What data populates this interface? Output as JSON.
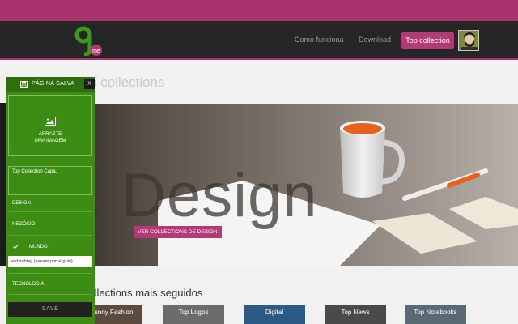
{
  "nav": {
    "logo_text": "me",
    "links": [
      "Como funciona",
      "Download"
    ],
    "cta": "Top collection"
  },
  "page": {
    "title": "Top collections"
  },
  "hero": {
    "word": "Design",
    "cta": "VER COLLECTIONS DE DESIGN"
  },
  "section": {
    "title": "Collections mais seguidos",
    "cards": [
      "Funny Fashion",
      "Top Logos",
      "Digital",
      "Top News",
      "Top Notebooks"
    ]
  },
  "panel": {
    "title": "PÁGINA SALVA",
    "close": "X",
    "drop_line1": "ARRASTE",
    "drop_line2": "UMA IMAGEM",
    "caption": "Top Collection Capa.",
    "categories": [
      "DESIGN",
      "NEGÓCIO",
      "MUNDO",
      "TECNOLOGIA"
    ],
    "subtag_value": "add subtag (separe por vírgula)",
    "save": "SAVE"
  },
  "colors": {
    "brand": "#a8336d",
    "panel_green": "#3d8c14",
    "navbar": "#262626"
  }
}
